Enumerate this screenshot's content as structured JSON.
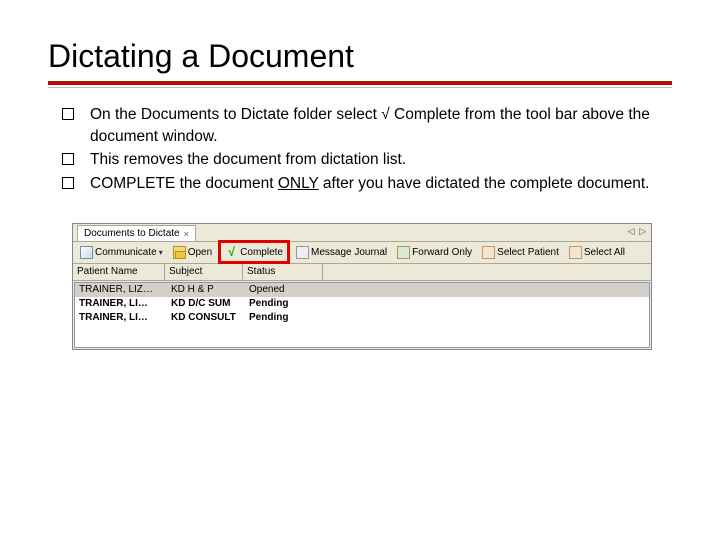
{
  "title": "Dictating a Document",
  "bullets": [
    "On the Documents to Dictate folder select √ Complete from the tool bar above the document window.",
    "This removes the document from dictation list.",
    "COMPLETE the document ONLY after you have dictated the complete document."
  ],
  "screenshot": {
    "tab": {
      "label": "Documents to Dictate",
      "close": "×",
      "nav": "◁ ▷"
    },
    "toolbar": {
      "communicate": "Communicate",
      "open": "Open",
      "complete": "Complete",
      "message_journal": "Message Journal",
      "forward_only": "Forward Only",
      "select_patient": "Select Patient",
      "select_all": "Select All"
    },
    "headers": {
      "patient": "Patient Name",
      "subject": "Subject",
      "status": "Status"
    },
    "rows": [
      {
        "patient": "TRAINER, LIZ…",
        "subject": "KD H & P",
        "status": "Opened"
      },
      {
        "patient": "TRAINER, LI…",
        "subject": "KD D/C SUM",
        "status": "Pending"
      },
      {
        "patient": "TRAINER, LI…",
        "subject": "KD CONSULT",
        "status": "Pending"
      }
    ]
  }
}
